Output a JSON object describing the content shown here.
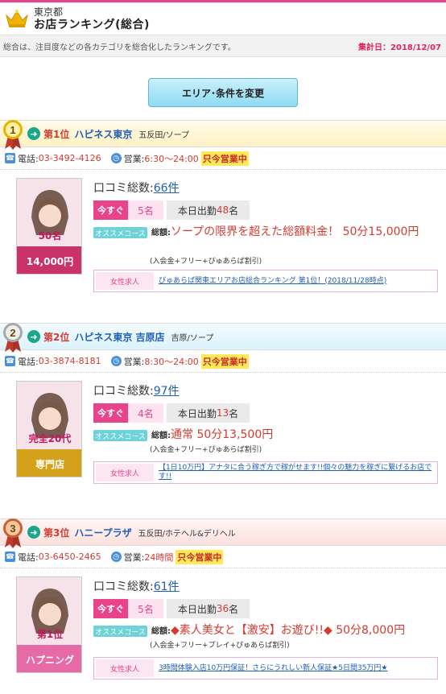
{
  "header": {
    "region": "東京都",
    "title": "お店ランキング(総合)"
  },
  "summary": {
    "description": "総合は、注目度などの各カテゴリを総合化したランキングです。",
    "date": "集計日：2018/12/07"
  },
  "change_button": "エリア･条件を変更",
  "labels": {
    "tel": "電話:",
    "hours": "営業:",
    "reviews_prefix": "口コミ総数:",
    "now": "今すぐ",
    "today_prefix": "本日出勤",
    "today_suffix": "名",
    "course": "オススメコース",
    "total": "総額:",
    "recruit": "女性求人"
  },
  "shops": [
    {
      "rank_number": "1",
      "rank_label": "第1位",
      "name": "ハピネス東京",
      "area": "五反田/ソープ",
      "tel": "03-3492-4126",
      "hours": "6:30〜24:00",
      "open_status": "只今営業中",
      "reviews": "66件",
      "now_count": "5名",
      "today_count": "48",
      "course": "ソープの限界を超えた総額料金！ 50分15,000円",
      "note": "(入会金+フリー+ぴゅあらば割引)",
      "recruit": "ぴゅあらば関東エリアお店総合ランキング 第1位！(2018/11/28時点)",
      "thumb_caption_top": "50名",
      "thumb_caption_bottom": "14,000円",
      "thumb_color": "#c8336a"
    },
    {
      "rank_number": "2",
      "rank_label": "第2位",
      "name": "ハピネス東京 吉原店",
      "area": "吉原/ソープ",
      "tel": "03-3874-8181",
      "hours": "8:30〜24:00",
      "open_status": "只今営業中",
      "reviews": "97件",
      "now_count": "4名",
      "today_count": "13",
      "course": "通常 50分13,500円",
      "note": "(入会金+フリー+ぴゅあらば割引)",
      "recruit": "【1日10万円】アナタに合う稼ぎ方で稼がせます!!個々の魅力を稼ぎに繋げるお店です!!",
      "thumb_caption_top": "完全20代",
      "thumb_caption_bottom": "専門店",
      "thumb_color": "#d4a21a"
    },
    {
      "rank_number": "3",
      "rank_label": "第3位",
      "name": "ハニープラザ",
      "area": "五反田/ホテヘル&デリヘル",
      "tel": "03-6450-2465",
      "hours": "24時間",
      "open_status": "只今営業中",
      "reviews": "61件",
      "now_count": "5名",
      "today_count": "36",
      "course": "◆素人美女と【激安】お遊び!!◆ 50分8,000円",
      "note": "(入会金+フリー+プレイ+ぴゅあらば割引)",
      "recruit": "3時間体験入店10万円保証！さらにうれしい新人保証★5日間35万円★",
      "thumb_caption_top": "第1位",
      "thumb_caption_bottom": "ハプニング",
      "thumb_color": "#e56aa6"
    }
  ],
  "colors": {
    "accent_pink": "#e8438b",
    "link_blue": "#1f5fb8",
    "price_red": "#d63a2f",
    "open_yellow": "#ffe95a",
    "button_blue": "#8fdaf2"
  }
}
